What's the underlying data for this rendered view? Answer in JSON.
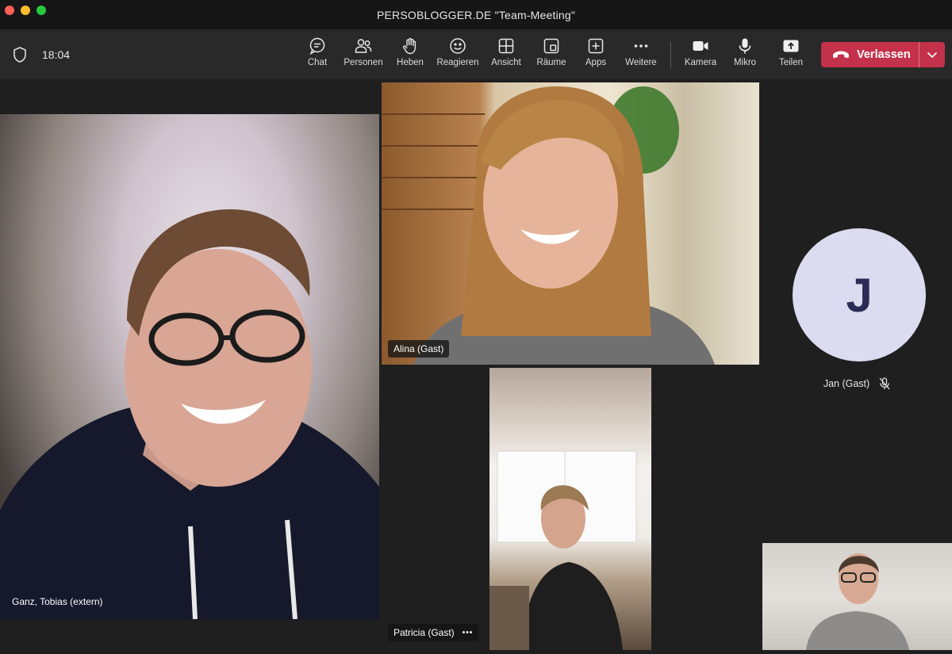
{
  "window": {
    "title": "PERSOBLOGGER.DE \"Team-Meeting\""
  },
  "toolbar": {
    "time": "18:04",
    "items": [
      {
        "id": "chat",
        "label": "Chat",
        "icon": "chat-icon"
      },
      {
        "id": "people",
        "label": "Personen",
        "icon": "people-icon"
      },
      {
        "id": "raise",
        "label": "Heben",
        "icon": "hand-icon"
      },
      {
        "id": "react",
        "label": "Reagieren",
        "icon": "smiley-icon"
      },
      {
        "id": "view",
        "label": "Ansicht",
        "icon": "grid-icon"
      },
      {
        "id": "rooms",
        "label": "Räume",
        "icon": "rooms-icon"
      },
      {
        "id": "apps",
        "label": "Apps",
        "icon": "plus-square-icon"
      },
      {
        "id": "more",
        "label": "Weitere",
        "icon": "more-icon"
      },
      {
        "id": "camera",
        "label": "Kamera",
        "icon": "camera-icon"
      },
      {
        "id": "mic",
        "label": "Mikro",
        "icon": "mic-icon"
      },
      {
        "id": "share",
        "label": "Teilen",
        "icon": "share-icon"
      }
    ],
    "leave_label": "Verlassen",
    "leave_color": "#c4314b"
  },
  "participants": {
    "tobias": {
      "name": "Ganz, Tobias (extern)"
    },
    "alina": {
      "name": "Alina (Gast)"
    },
    "patricia": {
      "name": "Patricia (Gast)",
      "menu": "•••"
    },
    "jan": {
      "name": "Jan (Gast)",
      "initial": "J",
      "muted": true,
      "avatar_color": "#dcdcf0"
    }
  }
}
